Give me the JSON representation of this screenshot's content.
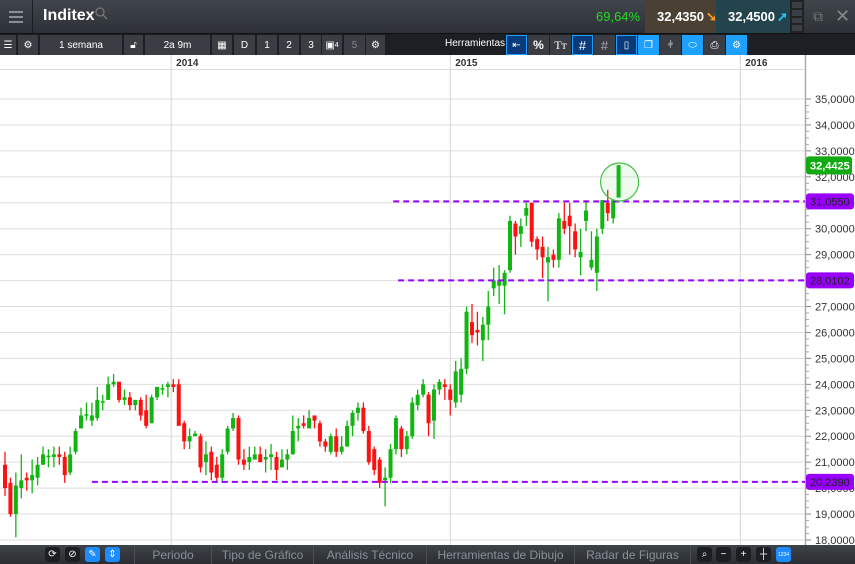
{
  "header": {
    "title": "Inditex",
    "change_pct": "69,64%",
    "bid": "32,4350",
    "ask": "32,4500",
    "colors": {
      "change": "#22dd22",
      "bid_arrow": "#ff9a1a",
      "ask_arrow": "#29c6ff"
    }
  },
  "toolbar": {
    "interval": "1 semana",
    "range": "2a 9m",
    "d": "D",
    "presets": [
      "1",
      "2",
      "3",
      "4",
      "5"
    ],
    "tools_label": "Herramientas",
    "percent": "%",
    "text_tool": "Tт"
  },
  "bottom": {
    "tabs": [
      "Periodo",
      "Tipo de Gráfico",
      "Análisis Técnico",
      "Herramientas de Dibujo",
      "Radar de Figuras"
    ],
    "zoom_badge": "1234"
  },
  "chart_data": {
    "type": "candlestick",
    "title": "Inditex",
    "interval": "weekly",
    "ylim": [
      18,
      35.6
    ],
    "y_ticks": [
      "35,0000",
      "34,0000",
      "33,0000",
      "32,0000",
      "31,0000",
      "30,0000",
      "29,0000",
      "28,0000",
      "27,0000",
      "26,0000",
      "25,0000",
      "24,0000",
      "23,0000",
      "22,0000",
      "21,0000",
      "20,0000",
      "19,0000",
      "18,0000"
    ],
    "y_tick_values": [
      35,
      34,
      33,
      32,
      31,
      30,
      29,
      28,
      27,
      26,
      25,
      24,
      23,
      22,
      21,
      20,
      19,
      18
    ],
    "x_ticks": [
      {
        "label": "2014",
        "index": 30.6
      },
      {
        "label": "2015",
        "index": 82
      },
      {
        "label": "2016",
        "index": 135.4
      }
    ],
    "last_price": {
      "label": "32,4425",
      "value": 32.4425,
      "color": "#11aa11"
    },
    "levels": [
      {
        "label": "31,0550",
        "value": 31.055,
        "from_index": 71.5,
        "color": "#9900ff"
      },
      {
        "label": "28,0102",
        "value": 28.0102,
        "from_index": 72.4,
        "color": "#9900ff"
      },
      {
        "label": "20,2390",
        "value": 20.239,
        "from_index": 16,
        "color": "#9900ff"
      }
    ],
    "highlight": {
      "index": 113,
      "price": 31.8
    },
    "up_color": "#11b511",
    "down_color": "#ff1111",
    "ohlc": [
      [
        20.9,
        21.4,
        19.7,
        20.0
      ],
      [
        20.2,
        20.4,
        18.9,
        19.0
      ],
      [
        19.0,
        20.6,
        18.1,
        20.1
      ],
      [
        20.0,
        21.3,
        19.6,
        20.3
      ],
      [
        20.4,
        20.6,
        19.9,
        20.3
      ],
      [
        20.3,
        21.1,
        19.8,
        20.5
      ],
      [
        20.4,
        21.2,
        20.1,
        20.9
      ],
      [
        20.9,
        21.6,
        20.9,
        21.3
      ],
      [
        21.2,
        21.5,
        20.8,
        21.25
      ],
      [
        21.2,
        21.6,
        20.8,
        21.3
      ],
      [
        21.3,
        21.6,
        20.9,
        21.2
      ],
      [
        21.2,
        21.4,
        20.2,
        20.5
      ],
      [
        20.6,
        21.6,
        20.5,
        21.3
      ],
      [
        21.4,
        22.3,
        21.3,
        22.2
      ],
      [
        22.3,
        23.1,
        22.3,
        22.8
      ],
      [
        22.8,
        23.3,
        22.6,
        22.85
      ],
      [
        22.6,
        23.3,
        22.4,
        22.8
      ],
      [
        22.7,
        23.9,
        22.6,
        23.4
      ],
      [
        23.3,
        23.6,
        23.0,
        23.35
      ],
      [
        23.4,
        24.3,
        23.4,
        24.0
      ],
      [
        24.0,
        24.4,
        23.9,
        24.1
      ],
      [
        24.1,
        24.1,
        23.3,
        23.4
      ],
      [
        23.4,
        23.8,
        23.2,
        23.5
      ],
      [
        23.5,
        23.7,
        23.0,
        23.2
      ],
      [
        23.2,
        23.4,
        23.0,
        23.4
      ],
      [
        23.4,
        23.5,
        22.6,
        22.8
      ],
      [
        23.0,
        23.6,
        22.3,
        22.4
      ],
      [
        22.5,
        23.6,
        22.5,
        23.5
      ],
      [
        23.5,
        23.9,
        23.4,
        23.9
      ],
      [
        23.8,
        24.0,
        23.6,
        23.85
      ],
      [
        23.9,
        24.1,
        23.5,
        24.0
      ],
      [
        24.0,
        24.2,
        23.7,
        23.9
      ],
      [
        24.0,
        24.2,
        22.4,
        22.4
      ],
      [
        22.5,
        22.6,
        21.5,
        21.8
      ],
      [
        21.8,
        22.3,
        21.5,
        22.0
      ],
      [
        22.0,
        22.2,
        22.0,
        22.1
      ],
      [
        22.0,
        22.1,
        20.6,
        20.8
      ],
      [
        21.0,
        21.8,
        20.5,
        21.3
      ],
      [
        21.4,
        21.6,
        20.3,
        20.6
      ],
      [
        20.9,
        21.2,
        20.2,
        20.4
      ],
      [
        20.4,
        21.5,
        20.2,
        21.3
      ],
      [
        21.4,
        22.4,
        21.3,
        22.3
      ],
      [
        22.3,
        22.9,
        22.2,
        22.7
      ],
      [
        22.7,
        22.8,
        20.9,
        21.1
      ],
      [
        21.1,
        21.5,
        20.7,
        20.9
      ],
      [
        21.0,
        21.6,
        20.7,
        21.2
      ],
      [
        21.1,
        21.6,
        21.1,
        21.3
      ],
      [
        21.3,
        21.6,
        21.0,
        21.0
      ],
      [
        21.1,
        21.5,
        20.6,
        21.2
      ],
      [
        21.2,
        21.7,
        20.7,
        21.3
      ],
      [
        21.2,
        21.4,
        20.3,
        20.7
      ],
      [
        20.8,
        21.5,
        20.8,
        21.1
      ],
      [
        21.1,
        21.5,
        20.7,
        21.3
      ],
      [
        21.3,
        22.8,
        21.3,
        22.2
      ],
      [
        22.3,
        22.7,
        21.8,
        22.4
      ],
      [
        22.5,
        22.8,
        22.3,
        22.4
      ],
      [
        22.3,
        23.0,
        22.3,
        22.7
      ],
      [
        22.8,
        22.8,
        22.3,
        22.6
      ],
      [
        22.5,
        22.6,
        21.6,
        21.8
      ],
      [
        21.8,
        21.9,
        21.4,
        21.6
      ],
      [
        21.4,
        22.1,
        21.3,
        22.0
      ],
      [
        22.0,
        22.3,
        21.2,
        21.4
      ],
      [
        21.4,
        22.0,
        21.3,
        21.6
      ],
      [
        21.6,
        22.6,
        21.6,
        22.4
      ],
      [
        22.4,
        23.0,
        22.0,
        22.9
      ],
      [
        22.9,
        23.3,
        22.6,
        23.1
      ],
      [
        23.1,
        23.3,
        22.1,
        22.2
      ],
      [
        22.2,
        22.4,
        20.9,
        21.0
      ],
      [
        21.5,
        21.6,
        20.5,
        20.7
      ],
      [
        21.1,
        21.2,
        20.0,
        20.2
      ],
      [
        20.3,
        20.8,
        19.3,
        20.4
      ],
      [
        20.4,
        21.7,
        20.2,
        21.5
      ],
      [
        21.5,
        22.8,
        21.3,
        22.7
      ],
      [
        22.3,
        22.4,
        21.2,
        21.5
      ],
      [
        21.5,
        22.2,
        21.3,
        22.0
      ],
      [
        22.0,
        23.5,
        21.9,
        23.3
      ],
      [
        23.2,
        23.8,
        23.0,
        23.6
      ],
      [
        23.6,
        24.2,
        23.5,
        24.0
      ],
      [
        23.6,
        23.7,
        22.0,
        22.5
      ],
      [
        22.6,
        24.0,
        21.9,
        23.8
      ],
      [
        23.8,
        24.2,
        23.6,
        24.1
      ],
      [
        24.0,
        24.2,
        23.4,
        23.9
      ],
      [
        23.8,
        24.0,
        22.8,
        23.4
      ],
      [
        23.3,
        24.9,
        23.1,
        24.5
      ],
      [
        23.6,
        25.0,
        23.3,
        24.6
      ],
      [
        24.6,
        27.0,
        24.4,
        26.8
      ],
      [
        26.4,
        27.1,
        25.6,
        25.9
      ],
      [
        26.1,
        26.8,
        25.5,
        26.0
      ],
      [
        25.7,
        26.6,
        24.9,
        26.3
      ],
      [
        26.3,
        27.6,
        25.7,
        27.0
      ],
      [
        27.7,
        28.5,
        27.4,
        28.0
      ],
      [
        27.8,
        28.6,
        27.1,
        28.0
      ],
      [
        27.8,
        28.4,
        26.7,
        28.3
      ],
      [
        28.4,
        30.5,
        28.3,
        30.3
      ],
      [
        30.2,
        30.3,
        29.0,
        29.7
      ],
      [
        29.8,
        30.4,
        29.3,
        30.1
      ],
      [
        30.5,
        31.0,
        30.1,
        30.8
      ],
      [
        31.0,
        31.0,
        29.3,
        29.5
      ],
      [
        29.6,
        29.7,
        28.8,
        29.2
      ],
      [
        29.3,
        29.7,
        28.1,
        28.9
      ],
      [
        28.7,
        29.3,
        27.2,
        28.9
      ],
      [
        29.0,
        29.2,
        28.5,
        28.8
      ],
      [
        28.8,
        30.6,
        28.5,
        30.4
      ],
      [
        30.3,
        31.0,
        29.8,
        30.0
      ],
      [
        30.5,
        31.0,
        29.0,
        30.1
      ],
      [
        29.9,
        30.2,
        28.9,
        29.2
      ],
      [
        28.9,
        30.0,
        28.2,
        29.1
      ],
      [
        30.3,
        31.1,
        29.9,
        30.7
      ],
      [
        28.5,
        29.9,
        28.4,
        28.8
      ],
      [
        28.3,
        30.0,
        27.6,
        29.7
      ],
      [
        30.0,
        31.1,
        29.8,
        31.1
      ],
      [
        31.0,
        31.5,
        30.3,
        30.6
      ],
      [
        30.4,
        31.1,
        30.2,
        31.1
      ],
      [
        31.2,
        32.45,
        31.2,
        32.45
      ]
    ]
  }
}
